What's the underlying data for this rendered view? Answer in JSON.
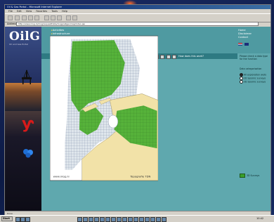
{
  "browser": {
    "title": "Oil & Gas Portal – Microsoft Internet Explorer",
    "menu": [
      "File",
      "Edit",
      "View",
      "Favorites",
      "Tools",
      "Help"
    ],
    "address_label": "Address",
    "address_url": "http://www.nlog.nl/nlog/requestData/nlogp/allgeomap/index.jsp"
  },
  "brand": {
    "logo": "OilG",
    "subtitle": "Oil and Gas Portal"
  },
  "nav": {
    "items": [
      "Activities",
      "Infrastructure",
      "Reserves and production",
      "Licences",
      "Data and publications",
      "Publications and documents"
    ],
    "right_links": [
      "Home",
      "Disclaimer",
      "Contact"
    ]
  },
  "crumb": {
    "prev": "Previous item",
    "current": "3D Seismic surveys",
    "help": "How does this work?"
  },
  "side": {
    "intro": "Please check a data type for the function",
    "heading": "Data categorisation",
    "options": [
      {
        "label": "All exploration wells",
        "selected": true
      },
      {
        "label": "2D Seismic surveys",
        "selected": false
      },
      {
        "label": "3D Seismic surveys",
        "selected": false
      }
    ],
    "legend_label": "3D Surveys"
  },
  "map": {
    "credit": "www.nlog.nl",
    "scale": "Topografie TDN"
  },
  "status": "Done",
  "taskbar": {
    "start": "Start",
    "clock": "10:42"
  },
  "colors": {
    "page_teal": "#5fa8ae",
    "survey_green": "#3aa02a",
    "land": "#f2e2a8",
    "sea": "#ffffff"
  }
}
